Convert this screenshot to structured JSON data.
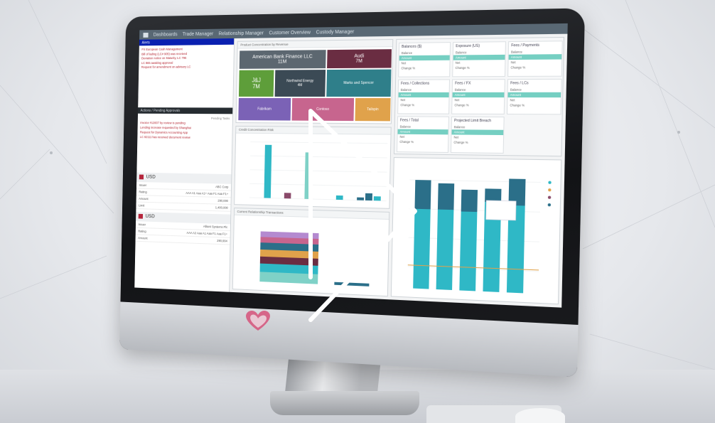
{
  "nav": {
    "items": [
      "Dashboards",
      "Trade Manager",
      "Relationship Manager",
      "Customer Overview",
      "Custody Manager"
    ]
  },
  "left_panel": {
    "alerts_header": "Alerts",
    "alerts_lines": [
      "FX European Cash Management",
      "Bill of lading (LC# 905) was received",
      "Deviation notice on Maturity, LC 796",
      "LC 865 awaiting approval",
      "Request for amendment on advisory LC"
    ],
    "approvals_header": "Actions / Pending Approvals",
    "approvals_lines": [
      "Pending Tasks",
      "Invoice #12837 by review is pending",
      "Lending increase requested by Shanghai",
      "Request for Dynamics Accounting App",
      "LC 92111 has received document review"
    ],
    "cards": [
      {
        "currency": "USD",
        "rows": [
          {
            "label": "Issuer",
            "value": "ABC Corp"
          },
          {
            "label": "Rating",
            "value": "AAA A1 Aaa A1+ Aaa F1 Aaa F1+"
          },
          {
            "label": "Amount",
            "value": "290,000"
          },
          {
            "label": "Limit",
            "value": "1,400,000"
          }
        ]
      },
      {
        "currency": "USD",
        "rows": [
          {
            "label": "Issuer",
            "value": "Alliant Systems Plc"
          },
          {
            "label": "Rating",
            "value": "AAA A2 Aaa A1 Aaa F1 Aaa F1+"
          },
          {
            "label": "Amount",
            "value": "290,904"
          }
        ]
      }
    ]
  },
  "treemap": {
    "title": "Product Concentration by Revenue",
    "boxes": [
      {
        "name": "American Bank Finance LLC",
        "value": "11M",
        "color": "#5c6770"
      },
      {
        "name": "Audi",
        "value": "7M",
        "color": "#6a2d42"
      },
      {
        "name": "J&J",
        "value": "7M",
        "color": "#5e9e3a"
      },
      {
        "name": "Northwind Energy",
        "value": "4M",
        "color": "#3b4a55"
      },
      {
        "name": "Marks and Spencer",
        "value": "",
        "color": "#2f7f8a"
      },
      {
        "name": "Fabrikam",
        "value": "",
        "color": "#7b62b6"
      },
      {
        "name": "Contoso",
        "value": "",
        "color": "#c7658e"
      },
      {
        "name": "Tailspin",
        "value": "",
        "color": "#e0a24b"
      }
    ]
  },
  "tiles": [
    {
      "title": "Balances ($)",
      "rows": [
        "Balance",
        "Amount",
        "Net",
        "Change %"
      ]
    },
    {
      "title": "Exposure (US)",
      "rows": [
        "Balance",
        "Amount",
        "Net",
        "Change %"
      ]
    },
    {
      "title": "Fees / Payments",
      "rows": [
        "Balance",
        "Amount",
        "Net",
        "Change %"
      ]
    },
    {
      "title": "Fees / Collections",
      "rows": [
        "Balance",
        "Amount",
        "Net",
        "Change %"
      ]
    },
    {
      "title": "Fees / FX",
      "rows": [
        "Balance",
        "Amount",
        "Net",
        "Change %"
      ]
    },
    {
      "title": "Fees / LCs",
      "rows": [
        "Balance",
        "Amount",
        "Net",
        "Change %"
      ]
    },
    {
      "title": "Fees / Total",
      "rows": [
        "Balance",
        "Amount",
        "Net",
        "Change %"
      ]
    },
    {
      "title": "Projected Limit Breach",
      "rows": [
        "Balance",
        "Amount",
        "Net",
        "Change %"
      ]
    }
  ],
  "bar_panel": {
    "title": "Credit Concentration Risk"
  },
  "stack_panel": {
    "title": "Current Relationship Transactions"
  },
  "colors": {
    "teal": "#2fb8c6",
    "dark_teal": "#2b6f89",
    "plum": "#8a4a6a",
    "aqua": "#7fd1c7"
  },
  "play_icon": "play-icon",
  "brand_logo": "heart-logo"
}
